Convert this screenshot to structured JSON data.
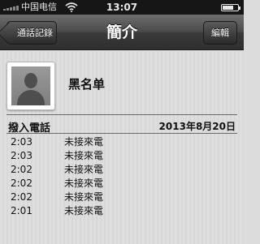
{
  "status_bar": {
    "carrier": "中国电信",
    "time": "13:07",
    "battery_level": 0.7
  },
  "nav": {
    "back_label": "通話記錄",
    "title": "簡介",
    "edit_label": "編輯"
  },
  "contact": {
    "name": "黑名单"
  },
  "calls": {
    "section_title": "撥入電話",
    "date": "2013年8月20日",
    "entries": [
      {
        "time": "2:03",
        "status": "未接來電"
      },
      {
        "time": "2:03",
        "status": "未接來電"
      },
      {
        "time": "2:02",
        "status": "未接來電"
      },
      {
        "time": "2:02",
        "status": "未接來電"
      },
      {
        "time": "2:02",
        "status": "未接來電"
      },
      {
        "time": "2:01",
        "status": "未接來電"
      }
    ]
  }
}
